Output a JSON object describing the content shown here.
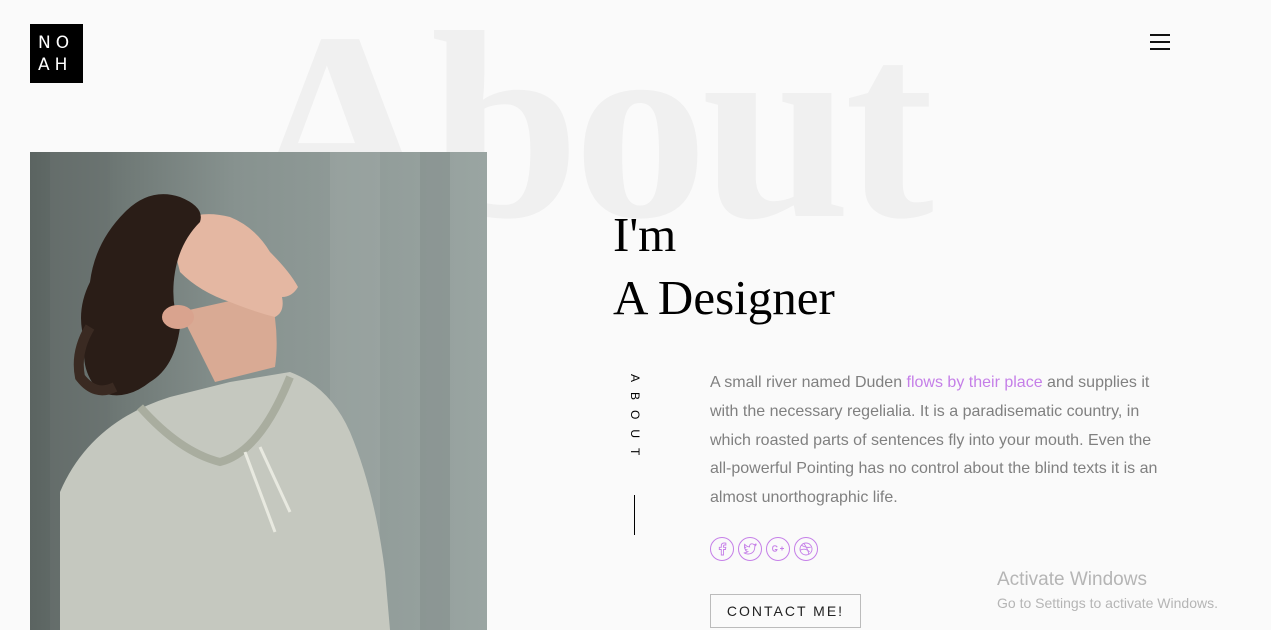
{
  "background_word": "About",
  "logo": {
    "line1": "NO",
    "line2": "AH"
  },
  "menu": {
    "icon": "hamburger-icon"
  },
  "hero": {
    "line1": "I'm",
    "line2": "A Designer"
  },
  "side_label": "ABOUT",
  "about": {
    "text_before": "A small river named Duden ",
    "link_text": "flows by their place",
    "text_after": " and supplies it with the necessary regelialia. It is a paradisematic country, in which roasted parts of sentences fly into your mouth. Even the all-powerful Pointing has no control about the blind texts it is an almost unorthographic life."
  },
  "social": [
    "facebook-icon",
    "twitter-icon",
    "google-plus-icon",
    "dribbble-icon"
  ],
  "contact_button": "CONTACT ME!",
  "watermark": {
    "title": "Activate Windows",
    "subtitle": "Go to Settings to activate Windows."
  },
  "colors": {
    "accent": "#c57fe8",
    "text_muted": "#808080",
    "background": "#fafafa",
    "logo_bg": "#000000"
  }
}
